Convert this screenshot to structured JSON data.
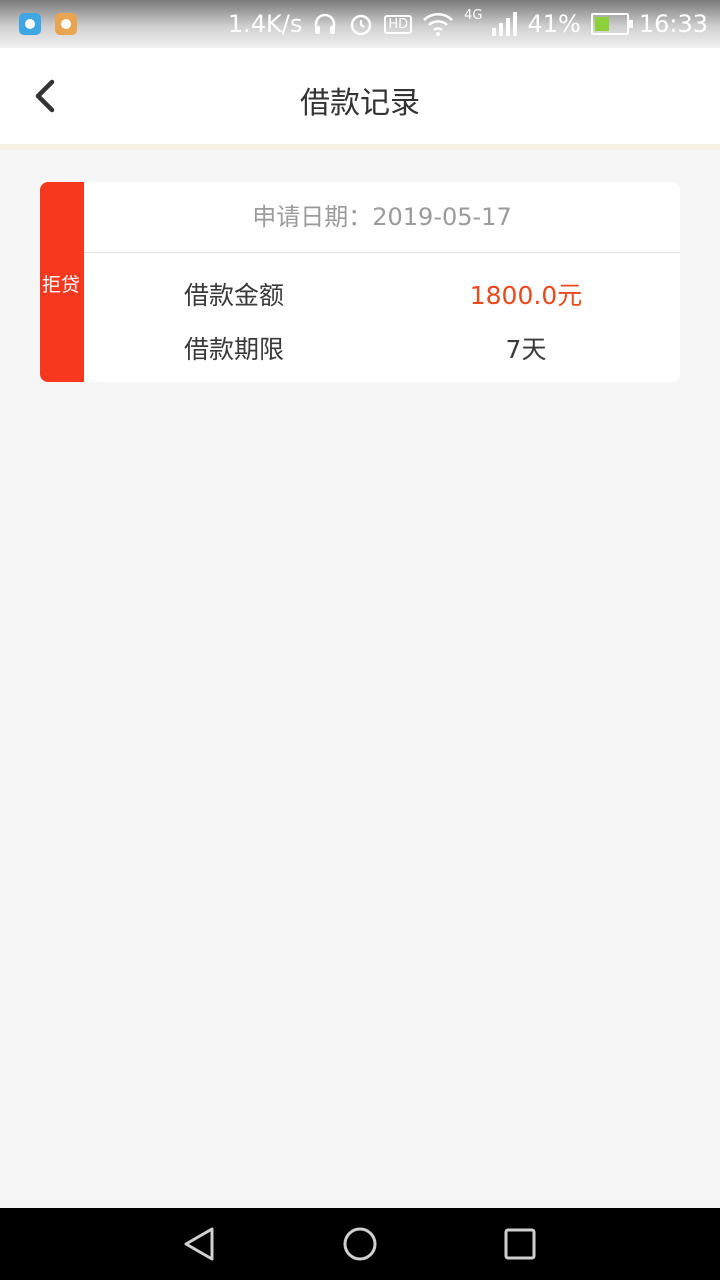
{
  "status_bar": {
    "network_speed": "1.4K/s",
    "network_type": "4G",
    "hd_label": "HD",
    "battery": "41%",
    "time": "16:33",
    "icons": [
      "app-icon-blue",
      "app-icon-orange",
      "headphone-icon",
      "alarm-icon",
      "hd-icon",
      "wifi-icon",
      "signal-icon",
      "battery-icon"
    ]
  },
  "header": {
    "title": "借款记录"
  },
  "records": [
    {
      "status": "拒贷",
      "date_text": "申请日期：2019-05-17",
      "amount_label": "借款金额",
      "amount_value": "1800.0元",
      "term_label": "借款期限",
      "term_value": "7天"
    }
  ],
  "colors": {
    "accent_red": "#f7381f",
    "amount_red": "#e84a1e",
    "page_bg": "#f6f6f6"
  }
}
